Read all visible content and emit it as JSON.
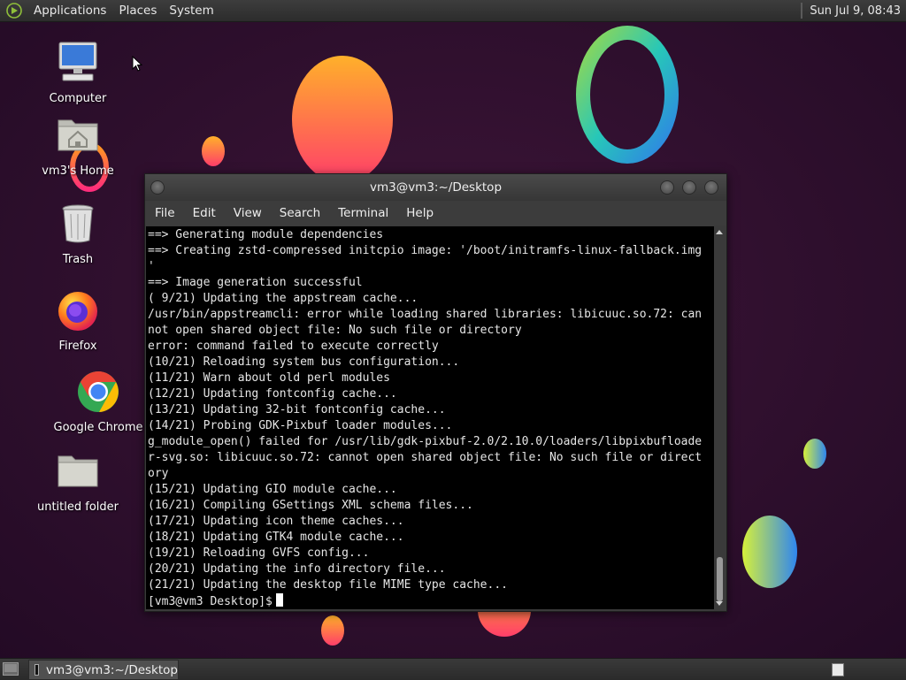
{
  "top_panel": {
    "menus": [
      "Applications",
      "Places",
      "System"
    ],
    "clock": "Sun Jul  9, 08:43"
  },
  "desktop_icons": [
    {
      "label": "Computer",
      "icon": "computer-icon"
    },
    {
      "label": "vm3's Home",
      "icon": "home-folder-icon"
    },
    {
      "label": "Trash",
      "icon": "trash-icon"
    },
    {
      "label": "Firefox",
      "icon": "firefox-icon"
    },
    {
      "label": "Google Chrome",
      "icon": "chrome-icon"
    },
    {
      "label": "untitled folder",
      "icon": "folder-icon"
    }
  ],
  "terminal": {
    "title": "vm3@vm3:~/Desktop",
    "menus": [
      "File",
      "Edit",
      "View",
      "Search",
      "Terminal",
      "Help"
    ],
    "lines": [
      "==> Generating module dependencies",
      "==> Creating zstd-compressed initcpio image: '/boot/initramfs-linux-fallback.img",
      "'",
      "==> Image generation successful",
      "( 9/21) Updating the appstream cache...",
      "/usr/bin/appstreamcli: error while loading shared libraries: libicuuc.so.72: can",
      "not open shared object file: No such file or directory",
      "error: command failed to execute correctly",
      "(10/21) Reloading system bus configuration...",
      "(11/21) Warn about old perl modules",
      "(12/21) Updating fontconfig cache...",
      "(13/21) Updating 32-bit fontconfig cache...",
      "(14/21) Probing GDK-Pixbuf loader modules...",
      "g_module_open() failed for /usr/lib/gdk-pixbuf-2.0/2.10.0/loaders/libpixbufloade",
      "r-svg.so: libicuuc.so.72: cannot open shared object file: No such file or direct",
      "ory",
      "(15/21) Updating GIO module cache...",
      "(16/21) Compiling GSettings XML schema files...",
      "(17/21) Updating icon theme caches...",
      "(18/21) Updating GTK4 module cache...",
      "(19/21) Reloading GVFS config...",
      "(20/21) Updating the info directory file...",
      "(21/21) Updating the desktop file MIME type cache..."
    ],
    "prompt": "[vm3@vm3 Desktop]$"
  },
  "taskbar": {
    "task_label": "vm3@vm3:~/Desktop"
  },
  "colors": {
    "wallpaper": "#2b0f2c",
    "terminal_bg": "#000000",
    "terminal_fg": "#e6e6e6"
  }
}
